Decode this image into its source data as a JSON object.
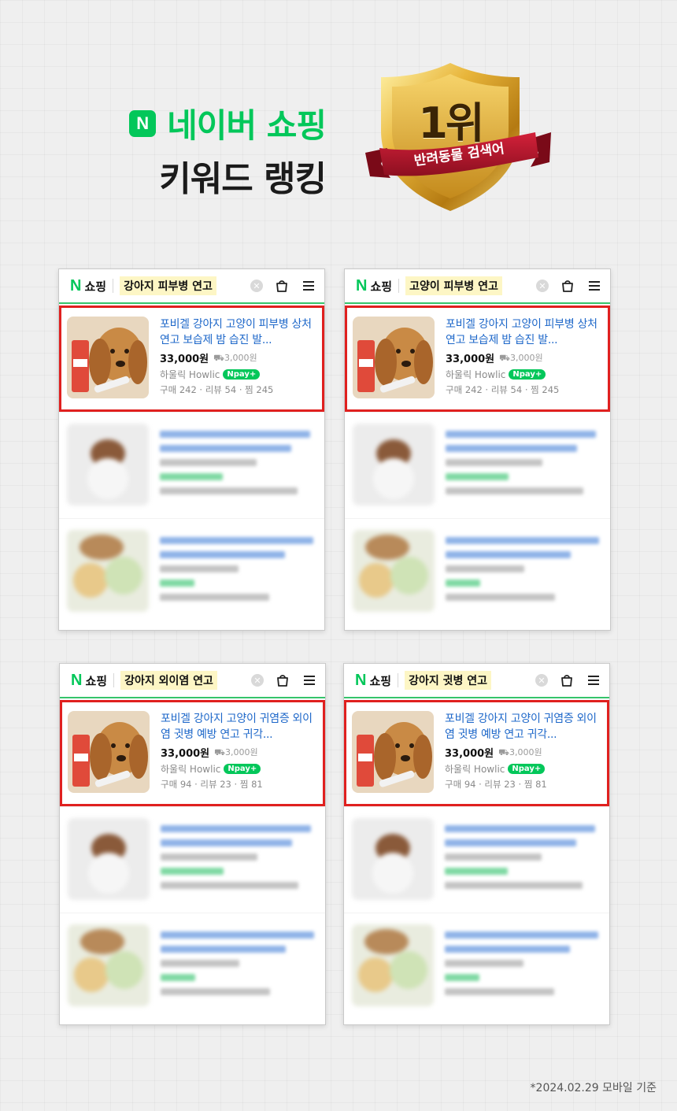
{
  "hero": {
    "logo_letter": "N",
    "brand": "네이버 쇼핑",
    "subtitle": "키워드 랭킹",
    "badge_rank": "1위",
    "badge_ribbon": "반려동물 검색어"
  },
  "colors": {
    "naver_green": "#03c75a",
    "highlight_red": "#e0201f",
    "link_blue": "#1d67c9",
    "gold": "#d9a320"
  },
  "panels": [
    {
      "header": {
        "n": "N",
        "label": "쇼핑",
        "keyword": "강아지 피부병 연고"
      },
      "featured": {
        "title": "포비겔 강아지 고양이 피부병 상처 연고 보습제 밤 습진 발...",
        "price": "33,000원",
        "shipping": "3,000원",
        "seller": "하울릭 Howlic",
        "npay": "pay",
        "stats": "구매 242 · 리뷰 54 · 찜 245"
      }
    },
    {
      "header": {
        "n": "N",
        "label": "쇼핑",
        "keyword": "고양이 피부병 연고"
      },
      "featured": {
        "title": "포비겔 강아지 고양이 피부병 상처 연고 보습제 밤 습진 발...",
        "price": "33,000원",
        "shipping": "3,000원",
        "seller": "하울릭 Howlic",
        "npay": "pay",
        "stats": "구매 242 · 리뷰 54 · 찜 245"
      }
    },
    {
      "header": {
        "n": "N",
        "label": "쇼핑",
        "keyword": "강아지 외이염 연고"
      },
      "featured": {
        "title": "포비겔 강아지 고양이 귀염증 외이염 귓병 예방 연고 귀각...",
        "price": "33,000원",
        "shipping": "3,000원",
        "seller": "하울릭 Howlic",
        "npay": "pay",
        "stats": "구매 94 · 리뷰 23 · 찜 81"
      }
    },
    {
      "header": {
        "n": "N",
        "label": "쇼핑",
        "keyword": "강아지 귓병 연고"
      },
      "featured": {
        "title": "포비겔 강아지 고양이 귀염증 외이염 귓병 예방 연고 귀각...",
        "price": "33,000원",
        "shipping": "3,000원",
        "seller": "하울릭 Howlic",
        "npay": "pay",
        "stats": "구매 94 · 리뷰 23 · 찜 81"
      }
    }
  ],
  "footnote": "*2024.02.29 모바일 기준"
}
